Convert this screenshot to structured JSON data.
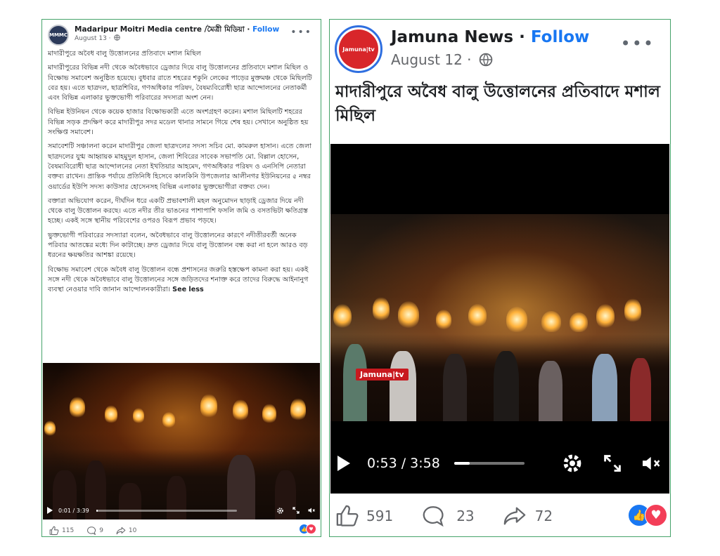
{
  "left_post": {
    "page_name": "Madaripur Moitri Media centre /মৈত্রী মিডিয়া",
    "follow": "Follow",
    "date": "August 13 ·",
    "avatar_text": "MMMC",
    "body": [
      "মাদারীপুরে অবৈধ বালু উত্তোলনের প্রতিবাদে মশাল মিছিল",
      "মাদারীপুরের বিভিন্ন নদী থেকে অবৈধভাবে ড্রেজার দিয়ে বালু উত্তোলনের প্রতিবাদে মশাল মিছিল ও বিক্ষোভ সমাবেশ অনুষ্ঠিত হয়েছে। বুধবার রাতে শহরের শকুনি লেকের পাড়ের মুক্তমঞ্চ থেকে মিছিলটি বের হয়। এতে ছাত্রদল, ছাত্রশিবির, গণঅধিকার পরিষদ, বৈষম্যবিরোধী ছাত্র আন্দোলনের নেতাকর্মী এবং বিভিন্ন এলাকার ভুক্তভোগী পরিবারের সদস্যরা অংশ নেন।",
      "বিভিন্ন ইউনিয়ন থেকে কয়েক হাজার বিক্ষোভকারী এতে অংশগ্রহণ করেন। মশাল মিছিলটি শহরের বিভিন্ন সড়ক প্রদক্ষিণ করে মাদারীপুর সদর মডেল থানার সামনে গিয়ে শেষ হয়। সেখানে অনুষ্ঠিত হয় সংক্ষিপ্ত সমাবেশ।",
      "সমাবেশটি সঞ্চালনা করেন মাদারীপুর জেলা ছাত্রদলের সদস্য সচিব মো. কামরুল হাসান। এতে জেলা ছাত্রদলের যুগ্ম আহ্বায়ক মাহমুদুল হাসান, জেলা শিবিরের সাবেক সভাপতি মো. বিল্লাল হোসেন, বৈষম্যবিরোধী ছাত্র আন্দোলনের নেতা ইখতিয়ার আহমেদ, গণঅধিকার পরিষদ ও এনসিপি নেতারা বক্তব্য রাখেন। প্রান্তিক পর্যায়ে প্রতিনিধি হিসেবে কালকিনি উপজেলার আলীনগর ইউনিয়নের ৫ নম্বর ওয়ার্ডের ইউপি সদস্য কাউসার হোসেনসহ বিভিন্ন এলাকার ভুক্তভোগীরা বক্তব্য দেন।",
      "বক্তারা অভিযোগ করেন, দীর্ঘদিন ধরে একটি প্রভাবশালী মহল অনুমোদন ছাড়াই ড্রেজার দিয়ে নদী থেকে বালু উত্তোলন করছে। এতে নদীর তীর ভাঙনের পাশাপাশি ফসলি জমি ও বসতভিটা ক্ষতিগ্রস্ত হচ্ছে। একই সঙ্গে স্থানীয় পরিবেশের ওপরও বিরূপ প্রভাব পড়ছে।",
      "ভুক্তভোগী পরিবারের সদস্যারা বলেন, অবৈধভাবে বালু উত্তোলনের কারণে নদীতীরবর্তী অনেক পরিবার আতঙ্কের মধ্যে দিন কাটাচ্ছে। দ্রুত ড্রেজার দিয়ে বালু উত্তোলন বন্ধ করা না হলে আরও বড় ধরনের ক্ষয়ক্ষতির আশঙ্কা রয়েছে।",
      "বিক্ষোভ সমাবেশ থেকে অবৈধ বালু উত্তোলন বন্ধে প্রশাসনের জরুরি হস্তক্ষেপ কামনা করা হয়। একই সঙ্গে নদী থেকে অবৈধভাবে বালু উত্তোলনের সঙ্গে জড়িতদের শনাক্ত করে তাদের বিরুদ্ধে আইনানুগ ব্যবস্থা নেওয়ার দাবি জানান আন্দোলনকারীরা।"
    ],
    "see_less": "See less",
    "video": {
      "time": "0:01 / 3:39",
      "progress": 0.01
    },
    "reactions": {
      "likes": "115",
      "comments": "9",
      "shares": "10"
    }
  },
  "right_post": {
    "page_name": "Jamuna News",
    "follow": "Follow",
    "date": "August 12 ·",
    "avatar_text": "Jamuna|tv",
    "headline": "মাদারীপুরে অবৈধ বালু উত্তোলনের প্রতিবাদে মশাল মিছিল",
    "watermark": "Jamuna|tv",
    "video": {
      "time": "0:53 / 3:58",
      "progress": 0.22
    },
    "reactions": {
      "likes": "591",
      "comments": "23",
      "shares": "72"
    }
  },
  "colors": {
    "border": "#46a36a",
    "follow": "#1877f2",
    "like": "#1877f2",
    "love": "#f33e58",
    "jamuna_red": "#c8191f"
  },
  "icons": [
    "globe-icon",
    "more-icon",
    "play-icon",
    "gear-icon",
    "fullscreen-icon",
    "mute-icon",
    "like-icon",
    "comment-icon",
    "share-icon"
  ]
}
